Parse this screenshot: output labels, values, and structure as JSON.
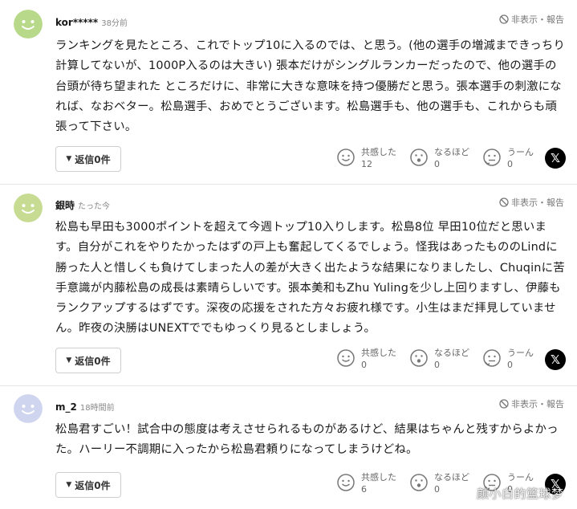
{
  "comments": [
    {
      "author": "kor*****",
      "time": "38分前",
      "report": "非表示・報告",
      "body": "ランキングを見たところ、これでトップ10に入るのでは、と思う。(他の選手の増減まできっちり計算してないが、1000P入るのは大きい) 張本だけがシングルランカーだったので、他の選手の台頭が待ち望まれた ところだけに、非常に大きな意味を持つ優勝だと思う。張本選手の刺激になれば、なおベター。松島選手、おめでとうございます。松島選手も、他の選手も、これからも頑張って下さい。",
      "reply": "返信0件",
      "reactions": [
        {
          "label": "共感した",
          "count": "12"
        },
        {
          "label": "なるほど",
          "count": "0"
        },
        {
          "label": "うーん",
          "count": "0"
        }
      ],
      "avatar_color": "#b8d98a"
    },
    {
      "author": "銀時",
      "time": "たった今",
      "report": "非表示・報告",
      "body": "松島も早田も3000ポイントを超えて今週トップ10入りします。松島8位 早田10位だと思います。自分がこれをやりたかったはずの戸上も奮起してくるでしょう。怪我はあったもののLindに勝った人と惜しくも負けてしまった人の差が大きく出たような結果になりましたし、Chuqinに苦手意識が内藤松島の成長は素晴らしいです。張本美和もZhu Yulingを少し上回りますし、伊藤もランクアップするはずです。深夜の応援をされた方々お疲れ様です。小生はまだ拝見していません。昨夜の決勝はUNEXTででもゆっくり見るとしましょう。",
      "reply": "返信0件",
      "reactions": [
        {
          "label": "共感した",
          "count": "0"
        },
        {
          "label": "なるほど",
          "count": "0"
        },
        {
          "label": "うーん",
          "count": "0"
        }
      ],
      "avatar_color": "#c7dc92"
    },
    {
      "author": "m_2",
      "time": "18時間前",
      "report": "非表示・報告",
      "body": "松島君すごい！試合中の態度は考えさせられるものがあるけど、結果はちゃんと残すからよかった。ハーリー不調期に入ったから松島君頼りになってしまうけどね。",
      "reply": "返信0件",
      "reactions": [
        {
          "label": "共感した",
          "count": "6"
        },
        {
          "label": "なるほど",
          "count": "0"
        },
        {
          "label": "うーん",
          "count": "0"
        }
      ],
      "avatar_color": "#cfd5ee"
    }
  ],
  "x_share": "𝕏",
  "watermark": "颜小白的篮球梦"
}
